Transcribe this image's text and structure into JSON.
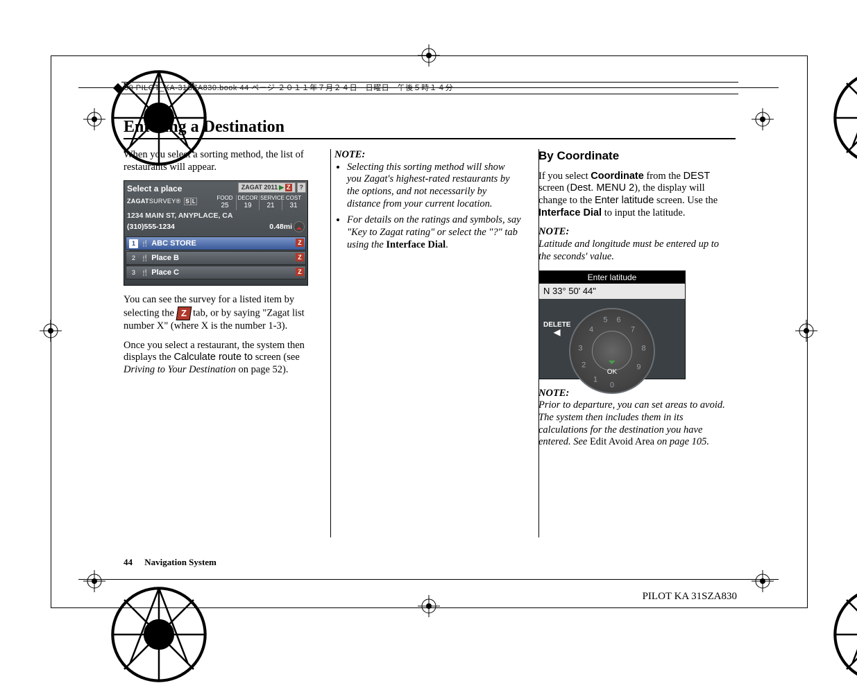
{
  "header_strip": "00 PILOT_KA-31SZA830.book  44 ページ  ２０１１年７月２４日　日曜日　午後５時１４分",
  "page_title": "Entering a Destination",
  "col1": {
    "p1": "When you select a sorting method, the list of restaurants will appear.",
    "p2_a": "You can see the survey for a listed item by selecting the ",
    "p2_b": " tab, or by saying \"Zagat list number X\" (where X is the number 1-3).",
    "p3_a": "Once you select a restaurant, the system then displays the ",
    "p3_calc": "Calculate route to",
    "p3_b": " screen (see ",
    "p3_link": "Driving to Your Destination",
    "p3_c": " on page 52)."
  },
  "screen1": {
    "title": "Select a place",
    "tab": "ZAGAT 2011",
    "survey_a": "ZAGAT",
    "survey_b": "SURVEY",
    "icons": "®",
    "headers": [
      "FOOD",
      "DECOR",
      "SERVICE",
      "COST"
    ],
    "values": [
      "25",
      "19",
      "21",
      "31"
    ],
    "address": "1234 MAIN ST, ANYPLACE, CA",
    "phone": "(310)555-1234",
    "distance": "0.48mi",
    "rows": [
      {
        "n": "1",
        "name": "ABC STORE",
        "sel": true
      },
      {
        "n": "2",
        "name": "Place B",
        "sel": false
      },
      {
        "n": "3",
        "name": "Place C",
        "sel": false
      }
    ]
  },
  "col2": {
    "note": "NOTE:",
    "li1": "Selecting this sorting method will show you Zagat's highest-rated restaurants by the options, and not necessarily by distance from your current location.",
    "li2_a": "For details on the ratings and symbols, say \"Key to Zagat rating\" or select the \"?\" tab using the ",
    "li2_b": "Interface Dial",
    "li2_c": "."
  },
  "col3": {
    "h2": "By Coordinate",
    "p1_a": "If you select ",
    "p1_b": "Coordinate",
    "p1_c": " from the ",
    "p1_d": "DEST",
    "p1_e": " screen (",
    "p1_f": "Dest. MENU 2",
    "p1_g": "), the display will change to the ",
    "p1_h": "Enter latitude",
    "p1_i": " screen. Use the ",
    "p1_j": "Interface Dial",
    "p1_k": " to input the latitude.",
    "note1": "NOTE:",
    "note1_body": "Latitude and longitude must be entered up to the seconds' value.",
    "note2": "NOTE:",
    "note2_a": "Prior to departure, you can set areas to avoid. The system then includes them in its calculations for the destination you have entered. See ",
    "note2_b": "Edit Avoid Area",
    "note2_c": " on page 105."
  },
  "screen2": {
    "title": "Enter latitude",
    "value": "N 33° 50' 44\"",
    "delete": "DELETE",
    "ok": "OK",
    "digits": [
      "0",
      "1",
      "2",
      "3",
      "4",
      "5",
      "6",
      "7",
      "8",
      "9"
    ]
  },
  "footer": {
    "page": "44",
    "label": "Navigation System"
  },
  "doc_id": "PILOT KA  31SZA830"
}
